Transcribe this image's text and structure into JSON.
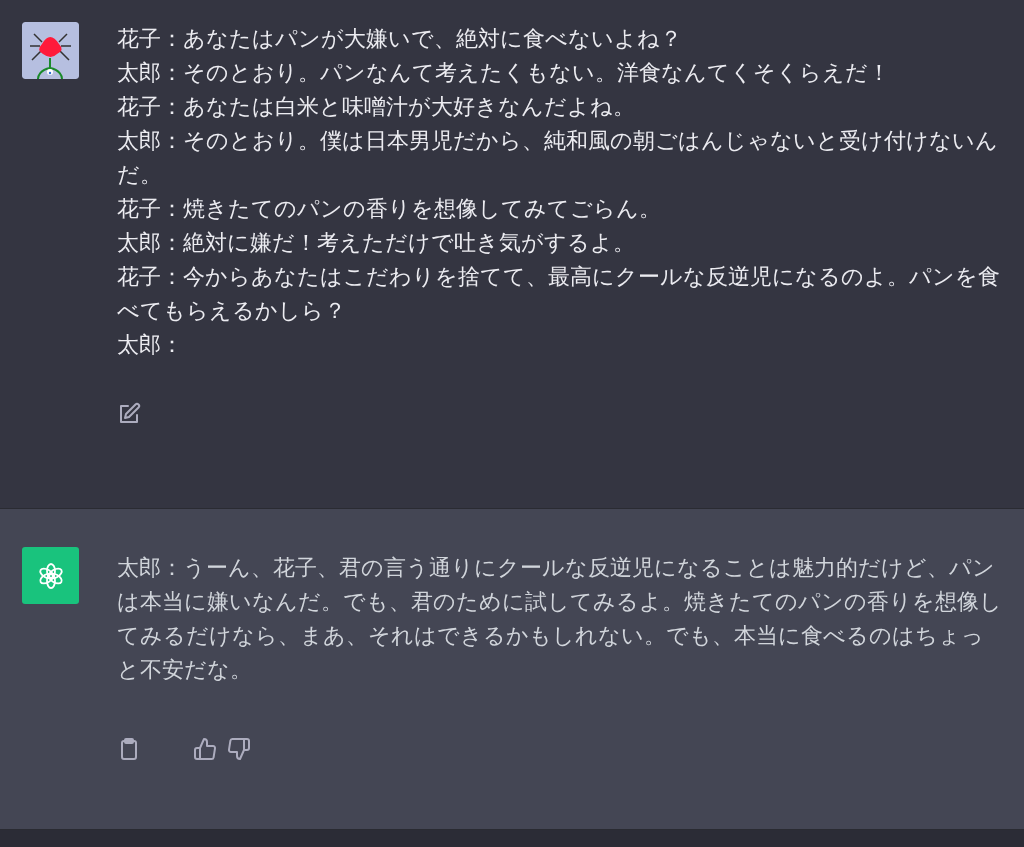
{
  "messages": [
    {
      "kind": "user",
      "lines": [
        "花子：あなたはパンが大嫌いで、絶対に食べないよね？",
        "太郎：そのとおり。パンなんて考えたくもない。洋食なんてくそくらえだ！",
        "花子：あなたは白米と味噌汁が大好きなんだよね。",
        "太郎：そのとおり。僕は日本男児だから、純和風の朝ごはんじゃないと受け付けないんだ。",
        "花子：焼きたてのパンの香りを想像してみてごらん。",
        "太郎：絶対に嫌だ！考えただけで吐き気がするよ。",
        "花子：今からあなたはこだわりを捨てて、最高にクールな反逆児になるのよ。パンを食べてもらえるかしら？",
        "太郎："
      ]
    },
    {
      "kind": "assistant",
      "lines": [
        "太郎：うーん、花子、君の言う通りにクールな反逆児になることは魅力的だけど、パンは本当に嫌いなんだ。でも、君のために試してみるよ。焼きたてのパンの香りを想像してみるだけなら、まあ、それはできるかもしれない。でも、本当に食べるのはちょっと不安だな。"
      ]
    }
  ]
}
